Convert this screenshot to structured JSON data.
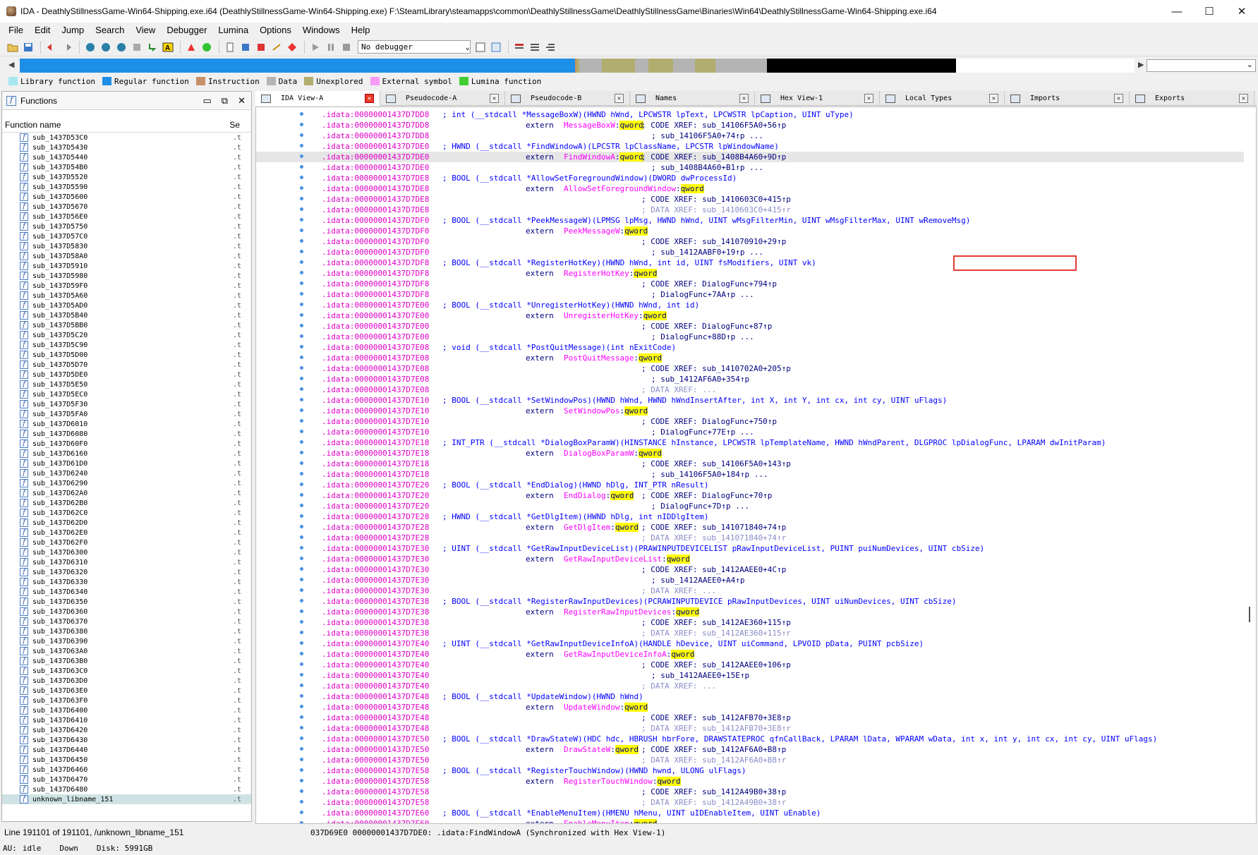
{
  "window": {
    "title": "IDA - DeathlyStillnessGame-Win64-Shipping.exe.i64 (DeathlyStillnessGame-Win64-Shipping.exe) F:\\SteamLibrary\\steamapps\\common\\DeathlyStillnessGame\\DeathlyStillnessGame\\Binaries\\Win64\\DeathlyStillnessGame-Win64-Shipping.exe.i64",
    "minimize": "—",
    "maximize": "☐",
    "close": "✕"
  },
  "menu": [
    "File",
    "Edit",
    "Jump",
    "Search",
    "View",
    "Debugger",
    "Lumina",
    "Options",
    "Windows",
    "Help"
  ],
  "toolbar": {
    "debugger": "No debugger"
  },
  "legend": [
    {
      "label": "Library function",
      "color": "#a6e7f2"
    },
    {
      "label": "Regular function",
      "color": "#1e8fe6"
    },
    {
      "label": "Instruction",
      "color": "#c79068"
    },
    {
      "label": "Data",
      "color": "#b4b4b4"
    },
    {
      "label": "Unexplored",
      "color": "#b1ad6e"
    },
    {
      "label": "External symbol",
      "color": "#f79cf5"
    },
    {
      "label": "Lumina function",
      "color": "#43cd33"
    }
  ],
  "navbar": [
    {
      "color": "#1e8fe6",
      "frac": 0.498
    },
    {
      "color": "#c79068",
      "frac": 0.0015
    },
    {
      "color": "#b1ad6e",
      "frac": 0.0025
    },
    {
      "color": "#b4b4b4",
      "frac": 0.02
    },
    {
      "color": "#b1ad6e",
      "frac": 0.03
    },
    {
      "color": "#b4b4b4",
      "frac": 0.012
    },
    {
      "color": "#b1ad6e",
      "frac": 0.022
    },
    {
      "color": "#b4b4b4",
      "frac": 0.02
    },
    {
      "color": "#b1ad6e",
      "frac": 0.018
    },
    {
      "color": "#b4b4b4",
      "frac": 0.046
    },
    {
      "color": "#000000",
      "frac": 0.17
    },
    {
      "color": "#ffffff",
      "frac": 0.16
    }
  ],
  "functions": {
    "title": "Functions",
    "col_name": "Function name",
    "col_seg": "Se",
    "seg_value": ".t",
    "items": [
      "sub_1437D53C0",
      "sub_1437D5430",
      "sub_1437D5440",
      "sub_1437D54B0",
      "sub_1437D5520",
      "sub_1437D5590",
      "sub_1437D5600",
      "sub_1437D5670",
      "sub_1437D56E0",
      "sub_1437D5750",
      "sub_1437D57C0",
      "sub_1437D5830",
      "sub_1437D58A0",
      "sub_1437D5910",
      "sub_1437D5980",
      "sub_1437D59F0",
      "sub_1437D5A60",
      "sub_1437D5AD0",
      "sub_1437D5B40",
      "sub_1437D5BB0",
      "sub_1437D5C20",
      "sub_1437D5C90",
      "sub_1437D5D00",
      "sub_1437D5D70",
      "sub_1437D5DE0",
      "sub_1437D5E50",
      "sub_1437D5EC0",
      "sub_1437D5F30",
      "sub_1437D5FA0",
      "sub_1437D6010",
      "sub_1437D6080",
      "sub_1437D60F0",
      "sub_1437D6160",
      "sub_1437D61D0",
      "sub_1437D6240",
      "sub_1437D6290",
      "sub_1437D62A0",
      "sub_1437D62B0",
      "sub_1437D62C0",
      "sub_1437D62D0",
      "sub_1437D62E0",
      "sub_1437D62F0",
      "sub_1437D6300",
      "sub_1437D6310",
      "sub_1437D6320",
      "sub_1437D6330",
      "sub_1437D6340",
      "sub_1437D6350",
      "sub_1437D6360",
      "sub_1437D6370",
      "sub_1437D6380",
      "sub_1437D6390",
      "sub_1437D63A0",
      "sub_1437D63B0",
      "sub_1437D63C0",
      "sub_1437D63D0",
      "sub_1437D63E0",
      "sub_1437D63F0",
      "sub_1437D6400",
      "sub_1437D6410",
      "sub_1437D6420",
      "sub_1437D6430",
      "sub_1437D6440",
      "sub_1437D6450",
      "sub_1437D6460",
      "sub_1437D6470",
      "sub_1437D6480",
      "unknown_libname_151"
    ],
    "status": "Line 191101 of 191101, /unknown_libname_151"
  },
  "tabs": [
    {
      "label": "IDA View-A",
      "active": true
    },
    {
      "label": "Pseudocode-A"
    },
    {
      "label": "Pseudocode-B"
    },
    {
      "label": "Names"
    },
    {
      "label": "Hex View-1"
    },
    {
      "label": "Local Types"
    },
    {
      "label": "Imports"
    },
    {
      "label": "Exports"
    }
  ],
  "code": [
    {
      "addr": ".idata:00000001437D7DD8",
      "text": "; int (__stdcall *MessageBoxW)(HWND hWnd, LPCWSTR lpText, LPCWSTR lpCaption, UINT uType)",
      "kind": "sig"
    },
    {
      "addr": ".idata:00000001437D7DD8",
      "ext": "MessageBoxW",
      "xref": "; CODE XREF: sub_14106F5A0+56↑p",
      "kind": "ext"
    },
    {
      "addr": ".idata:00000001437D7DD8",
      "xref": "; sub_14106F5A0+74↑p ...",
      "kind": "code2"
    },
    {
      "addr": ".idata:00000001437D7DE0",
      "text": "; HWND (__stdcall *FindWindowA)(LPCSTR lpClassName, LPCSTR lpWindowName)",
      "kind": "sig"
    },
    {
      "addr": ".idata:00000001437D7DE0",
      "ext": "FindWindowA",
      "xref": "; CODE XREF: sub_1408B4A60+9D↑p",
      "kind": "ext",
      "hl": true
    },
    {
      "addr": ".idata:00000001437D7DE0",
      "xref": "; sub_1408B4A60+B1↑p ...",
      "kind": "code2"
    },
    {
      "addr": ".idata:00000001437D7DE8",
      "text": "; BOOL (__stdcall *AllowSetForegroundWindow)(DWORD dwProcessId)",
      "kind": "sig"
    },
    {
      "addr": ".idata:00000001437D7DE8",
      "ext": "AllowSetForegroundWindow",
      "kind": "ext"
    },
    {
      "addr": ".idata:00000001437D7DE8",
      "xref": "; CODE XREF: sub_1410603C0+415↑p",
      "kind": "code"
    },
    {
      "addr": ".idata:00000001437D7DE8",
      "xref": "; DATA XREF: sub_1410603C0+415↑r",
      "kind": "data"
    },
    {
      "addr": ".idata:00000001437D7DF0",
      "text": "; BOOL (__stdcall *PeekMessageW)(LPMSG lpMsg, HWND hWnd, UINT wMsgFilterMin, UINT wMsgFilterMax, UINT wRemoveMsg)",
      "kind": "sig"
    },
    {
      "addr": ".idata:00000001437D7DF0",
      "ext": "PeekMessageW",
      "kind": "ext"
    },
    {
      "addr": ".idata:00000001437D7DF0",
      "xref": "; CODE XREF: sub_141070910+29↑p",
      "kind": "code"
    },
    {
      "addr": ".idata:00000001437D7DF0",
      "xref": "; sub_1412AABF0+19↑p ...",
      "kind": "code2"
    },
    {
      "addr": ".idata:00000001437D7DF8",
      "text": "; BOOL (__stdcall *RegisterHotKey)(HWND hWnd, int id, UINT fsModifiers, UINT vk)",
      "kind": "sig"
    },
    {
      "addr": ".idata:00000001437D7DF8",
      "ext": "RegisterHotKey",
      "kind": "ext"
    },
    {
      "addr": ".idata:00000001437D7DF8",
      "xref": "; CODE XREF: DialogFunc+794↑p",
      "kind": "code"
    },
    {
      "addr": ".idata:00000001437D7DF8",
      "xref": "; DialogFunc+7AA↑p ...",
      "kind": "code2"
    },
    {
      "addr": ".idata:00000001437D7E00",
      "text": "; BOOL (__stdcall *UnregisterHotKey)(HWND hWnd, int id)",
      "kind": "sig"
    },
    {
      "addr": ".idata:00000001437D7E00",
      "ext": "UnregisterHotKey",
      "kind": "ext"
    },
    {
      "addr": ".idata:00000001437D7E00",
      "xref": "; CODE XREF: DialogFunc+87↑p",
      "kind": "code"
    },
    {
      "addr": ".idata:00000001437D7E00",
      "xref": "; DialogFunc+88D↑p ...",
      "kind": "code2"
    },
    {
      "addr": ".idata:00000001437D7E08",
      "text": "; void (__stdcall *PostQuitMessage)(int nExitCode)",
      "kind": "sig"
    },
    {
      "addr": ".idata:00000001437D7E08",
      "ext": "PostQuitMessage",
      "kind": "ext"
    },
    {
      "addr": ".idata:00000001437D7E08",
      "xref": "; CODE XREF: sub_1410702A0+205↑p",
      "kind": "code"
    },
    {
      "addr": ".idata:00000001437D7E08",
      "xref": "; sub_1412AF6A0+354↑p",
      "kind": "code2"
    },
    {
      "addr": ".idata:00000001437D7E08",
      "xref": "; DATA XREF: ...",
      "kind": "data"
    },
    {
      "addr": ".idata:00000001437D7E10",
      "text": "; BOOL (__stdcall *SetWindowPos)(HWND hWnd, HWND hWndInsertAfter, int X, int Y, int cx, int cy, UINT uFlags)",
      "kind": "sig"
    },
    {
      "addr": ".idata:00000001437D7E10",
      "ext": "SetWindowPos",
      "kind": "ext"
    },
    {
      "addr": ".idata:00000001437D7E10",
      "xref": "; CODE XREF: DialogFunc+750↑p",
      "kind": "code"
    },
    {
      "addr": ".idata:00000001437D7E10",
      "xref": "; DialogFunc+77E↑p ...",
      "kind": "code2"
    },
    {
      "addr": ".idata:00000001437D7E18",
      "text": "; INT_PTR (__stdcall *DialogBoxParamW)(HINSTANCE hInstance, LPCWSTR lpTemplateName, HWND hWndParent, DLGPROC lpDialogFunc, LPARAM dwInitParam)",
      "kind": "sig"
    },
    {
      "addr": ".idata:00000001437D7E18",
      "ext": "DialogBoxParamW",
      "kind": "ext"
    },
    {
      "addr": ".idata:00000001437D7E18",
      "xref": "; CODE XREF: sub_14106F5A0+143↑p",
      "kind": "code"
    },
    {
      "addr": ".idata:00000001437D7E18",
      "xref": "; sub_14106F5A0+184↑p ...",
      "kind": "code2"
    },
    {
      "addr": ".idata:00000001437D7E20",
      "text": "; BOOL (__stdcall *EndDialog)(HWND hDlg, INT_PTR nResult)",
      "kind": "sig"
    },
    {
      "addr": ".idata:00000001437D7E20",
      "ext": "EndDialog",
      "xref": "; CODE XREF: DialogFunc+70↑p",
      "kind": "ext"
    },
    {
      "addr": ".idata:00000001437D7E20",
      "xref": "; DialogFunc+7D↑p ...",
      "kind": "code2"
    },
    {
      "addr": ".idata:00000001437D7E28",
      "text": "; HWND (__stdcall *GetDlgItem)(HWND hDlg, int nIDDlgItem)",
      "kind": "sig"
    },
    {
      "addr": ".idata:00000001437D7E28",
      "ext": "GetDlgItem",
      "xref": "; CODE XREF: sub_141071840+74↑p",
      "kind": "ext"
    },
    {
      "addr": ".idata:00000001437D7E28",
      "xref": "; DATA XREF: sub_141071840+74↑r",
      "kind": "data"
    },
    {
      "addr": ".idata:00000001437D7E30",
      "text": "; UINT (__stdcall *GetRawInputDeviceList)(PRAWINPUTDEVICELIST pRawInputDeviceList, PUINT puiNumDevices, UINT cbSize)",
      "kind": "sig"
    },
    {
      "addr": ".idata:00000001437D7E30",
      "ext": "GetRawInputDeviceList",
      "kind": "ext"
    },
    {
      "addr": ".idata:00000001437D7E30",
      "xref": "; CODE XREF: sub_1412AAEE0+4C↑p",
      "kind": "code"
    },
    {
      "addr": ".idata:00000001437D7E30",
      "xref": "; sub_1412AAEE0+A4↑p",
      "kind": "code2"
    },
    {
      "addr": ".idata:00000001437D7E30",
      "xref": "; DATA XREF: ...",
      "kind": "data"
    },
    {
      "addr": ".idata:00000001437D7E38",
      "text": "; BOOL (__stdcall *RegisterRawInputDevices)(PCRAWINPUTDEVICE pRawInputDevices, UINT uiNumDevices, UINT cbSize)",
      "kind": "sig"
    },
    {
      "addr": ".idata:00000001437D7E38",
      "ext": "RegisterRawInputDevices",
      "kind": "ext"
    },
    {
      "addr": ".idata:00000001437D7E38",
      "xref": "; CODE XREF: sub_1412AE360+115↑p",
      "kind": "code"
    },
    {
      "addr": ".idata:00000001437D7E38",
      "xref": "; DATA XREF: sub_1412AE360+115↑r",
      "kind": "data"
    },
    {
      "addr": ".idata:00000001437D7E40",
      "text": "; UINT (__stdcall *GetRawInputDeviceInfoA)(HANDLE hDevice, UINT uiCommand, LPVOID pData, PUINT pcbSize)",
      "kind": "sig"
    },
    {
      "addr": ".idata:00000001437D7E40",
      "ext": "GetRawInputDeviceInfoA",
      "kind": "ext"
    },
    {
      "addr": ".idata:00000001437D7E40",
      "xref": "; CODE XREF: sub_1412AAEE0+106↑p",
      "kind": "code"
    },
    {
      "addr": ".idata:00000001437D7E40",
      "xref": "; sub_1412AAEE0+15E↑p",
      "kind": "code2"
    },
    {
      "addr": ".idata:00000001437D7E40",
      "xref": "; DATA XREF: ...",
      "kind": "data"
    },
    {
      "addr": ".idata:00000001437D7E48",
      "text": "; BOOL (__stdcall *UpdateWindow)(HWND hWnd)",
      "kind": "sig"
    },
    {
      "addr": ".idata:00000001437D7E48",
      "ext": "UpdateWindow",
      "kind": "ext"
    },
    {
      "addr": ".idata:00000001437D7E48",
      "xref": "; CODE XREF: sub_1412AFB70+3E8↑p",
      "kind": "code"
    },
    {
      "addr": ".idata:00000001437D7E48",
      "xref": "; DATA XREF: sub_1412AFB70+3E8↑r",
      "kind": "data"
    },
    {
      "addr": ".idata:00000001437D7E50",
      "text": "; BOOL (__stdcall *DrawStateW)(HDC hdc, HBRUSH hbrFore, DRAWSTATEPROC qfnCallBack, LPARAM lData, WPARAM wData, int x, int y, int cx, int cy, UINT uFlags)",
      "kind": "sig"
    },
    {
      "addr": ".idata:00000001437D7E50",
      "ext": "DrawStateW",
      "xref": "; CODE XREF: sub_1412AF6A0+B8↑p",
      "kind": "ext"
    },
    {
      "addr": ".idata:00000001437D7E50",
      "xref": "; DATA XREF: sub_1412AF6A0+B8↑r",
      "kind": "data"
    },
    {
      "addr": ".idata:00000001437D7E58",
      "text": "; BOOL (__stdcall *RegisterTouchWindow)(HWND hwnd, ULONG ulFlags)",
      "kind": "sig"
    },
    {
      "addr": ".idata:00000001437D7E58",
      "ext": "RegisterTouchWindow",
      "kind": "ext"
    },
    {
      "addr": ".idata:00000001437D7E58",
      "xref": "; CODE XREF: sub_1412A49B0+38↑p",
      "kind": "code"
    },
    {
      "addr": ".idata:00000001437D7E58",
      "xref": "; DATA XREF: sub_1412A49B0+38↑r",
      "kind": "data"
    },
    {
      "addr": ".idata:00000001437D7E60",
      "text": "; BOOL (__stdcall *EnableMenuItem)(HMENU hMenu, UINT uIDEnableItem, UINT uEnable)",
      "kind": "sig"
    },
    {
      "addr": ".idata:00000001437D7E60",
      "ext": "EnableMenuItem",
      "kind": "ext"
    }
  ],
  "extern_kw": "extern",
  "qword": "qword",
  "view_status": "037D69E0 00000001437D7DE0: .idata:FindWindowA (Synchronized with Hex View-1)",
  "status": {
    "au": "AU:",
    "state": "idle",
    "dir": "Down",
    "disk": "Disk: 5991GB"
  }
}
